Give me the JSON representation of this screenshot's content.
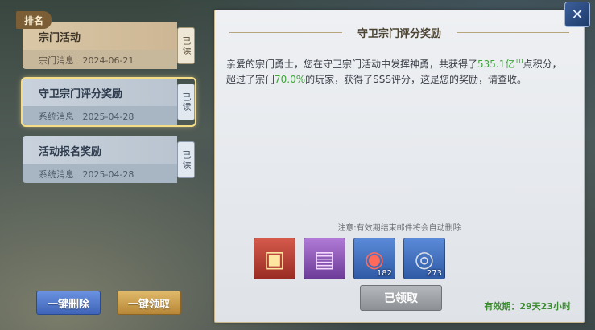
{
  "sidebar": {
    "tag": "排名",
    "mails": [
      {
        "title": "宗门活动",
        "sender": "宗门消息",
        "date": "2024-06-21",
        "status": "已读"
      },
      {
        "title": "守卫宗门评分奖励",
        "sender": "系统消息",
        "date": "2025-04-28",
        "status": "已读"
      },
      {
        "title": "活动报名奖励",
        "sender": "系统消息",
        "date": "2025-04-28",
        "status": "已读"
      }
    ],
    "delete_all_label": "一键删除",
    "claim_all_label": "一键领取"
  },
  "mail": {
    "title": "守卫宗门评分奖励",
    "body_pre": "亲爱的宗门勇士，您在守卫宗门活动中发挥神勇，共获得了",
    "points": "535.1亿",
    "points_sup": "10",
    "body_mid": "点积分，超过了宗门",
    "percent": "70.0%",
    "body_post": "的玩家，获得了SSS评分，这是您的奖励，请查收。",
    "notice": "注意:有效期结束邮件将会自动删除",
    "items": [
      {
        "icon": "treasure-chest-red-icon",
        "qty": ""
      },
      {
        "icon": "treasure-chest-purple-icon",
        "qty": ""
      },
      {
        "icon": "red-gem-icon",
        "qty": "182"
      },
      {
        "icon": "silver-coins-icon",
        "qty": "273"
      }
    ],
    "claimed_label": "已领取",
    "expiry": "有效期：29天23小时"
  },
  "colors": {
    "highlight": "#3fa33b",
    "accent_gold": "#c9b58b"
  }
}
